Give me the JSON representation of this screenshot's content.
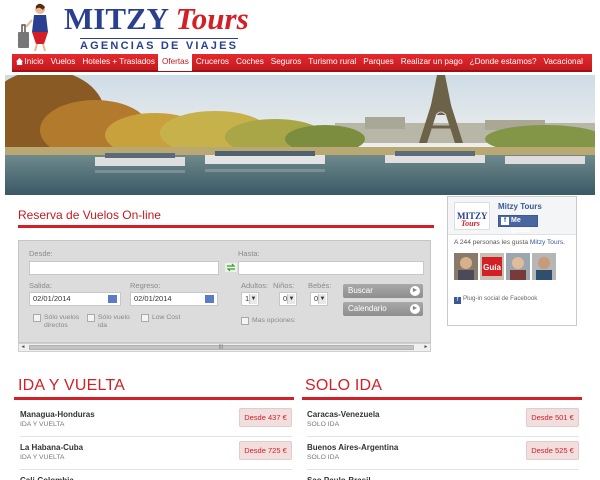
{
  "brand": {
    "main": "MITZY",
    "accent": "Tours",
    "subtitle": "AGENCIAS DE VIAJES"
  },
  "nav": {
    "items": [
      "Inicio",
      "Vuelos",
      "Hoteles + Traslados",
      "Ofertas",
      "Cruceros",
      "Coches",
      "Seguros",
      "Turismo rural",
      "Parques",
      "Realizar un pago",
      "¿Donde estamos?",
      "Vacacional"
    ],
    "active": "Ofertas"
  },
  "booking": {
    "title": "Reserva de Vuelos On-line",
    "from_label": "Desde:",
    "to_label": "Hasta:",
    "depart_label": "Salida:",
    "return_label": "Regreso:",
    "depart_value": "02/01/2014",
    "return_value": "02/01/2014",
    "adults_label": "Adultos:",
    "children_label": "Niños:",
    "babies_label": "Bebés:",
    "adults_value": "1",
    "children_value": "0",
    "babies_value": "0",
    "search_button": "Buscar",
    "calendar_button": "Calendario",
    "direct_only": "Sólo vuelos directos",
    "oneway_only": "Sólo vuelo ida",
    "low_cost": "Low Cost",
    "more_options": "Mas opciones:"
  },
  "facebook": {
    "page_name": "Mitzy Tours",
    "like_button": "Me gusta",
    "count_text": "A 244 personas les gusta",
    "count_link": "Mitzy Tours.",
    "logo_main": "MITZY",
    "logo_accent": "Tours",
    "guide_text": "Guía",
    "plugin_text": "Plug-in social de Facebook"
  },
  "roundtrip": {
    "title": "IDA Y VUELTA",
    "routes": [
      {
        "name": "Managua-Honduras",
        "type": "IDA Y VUELTA",
        "price": "Desde 437 €"
      },
      {
        "name": "La Habana-Cuba",
        "type": "IDA Y VUELTA",
        "price": "Desde 725 €"
      },
      {
        "name": "Cali-Colombia",
        "type": "",
        "price": ""
      }
    ]
  },
  "oneway": {
    "title": "SOLO IDA",
    "routes": [
      {
        "name": "Caracas-Venezuela",
        "type": "SOLO IDA",
        "price": "Desde 501 €"
      },
      {
        "name": "Buenos Aires-Argentina",
        "type": "SOLO IDA",
        "price": "Desde 525 €"
      },
      {
        "name": "Sao Paulo-Brasil",
        "type": "",
        "price": ""
      }
    ]
  },
  "colors": {
    "brand_red": "#d32027",
    "brand_blue": "#2a3f8f",
    "facebook_blue": "#3b5998"
  },
  "icons": [
    "home-icon",
    "swap-icon",
    "calendar-icon",
    "chevron-down-icon",
    "arrow-right-icon",
    "facebook-icon"
  ]
}
